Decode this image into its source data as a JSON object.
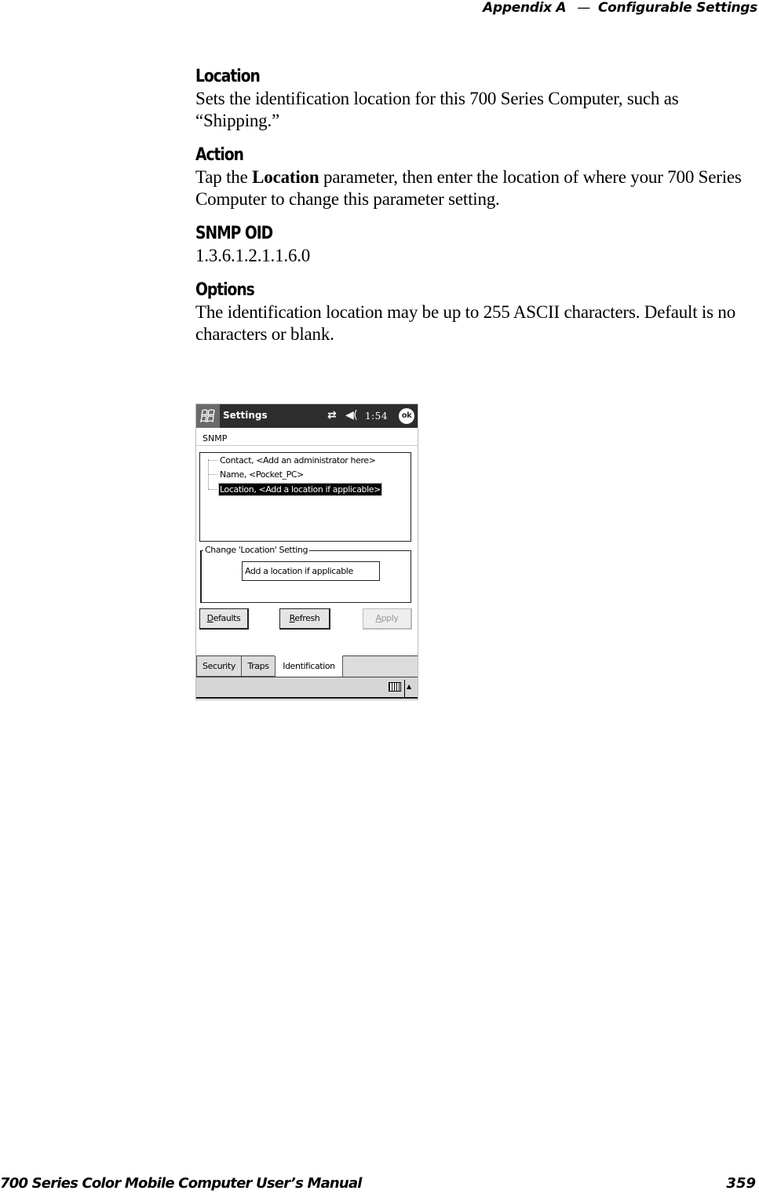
{
  "running_header": {
    "appendix": "Appendix A",
    "separator": "—",
    "chapter": "Configurable Settings"
  },
  "sections": [
    {
      "heading": "Location",
      "body": "Sets the identification location for this 700 Series Computer, such as “Shipping.”"
    },
    {
      "heading": "Action",
      "body_prefix": "Tap the ",
      "body_bold": "Location",
      "body_suffix": " parameter, then enter the location of where your 700 Series Computer to change this parameter setting."
    },
    {
      "heading": "SNMP OID",
      "body": "1.3.6.1.2.1.1.6.0"
    },
    {
      "heading": "Options",
      "body": "The identification location may be up to 255 ASCII characters. Default is no characters or blank."
    }
  ],
  "device_screen": {
    "titlebar": {
      "start_icon": "windows-flag-icon",
      "title": "Settings",
      "connectivity_icon": "connectivity-arrows-icon",
      "connectivity_glyph": "⇄",
      "volume_icon": "speaker-icon",
      "volume_glyph": "◀(",
      "time": "1:54",
      "ok_label": "ok"
    },
    "page_label": "SNMP",
    "tree_items": [
      {
        "label": "Contact,  <Add an administrator here>",
        "selected": false
      },
      {
        "label": "Name,  <Pocket_PC>",
        "selected": false
      },
      {
        "label": "Location,  <Add a location if applicable>",
        "selected": true
      }
    ],
    "groupbox": {
      "legend": "Change 'Location' Setting",
      "input_value": "Add a location if applicable"
    },
    "buttons": {
      "defaults_mnemonic": "D",
      "defaults_rest": "efaults",
      "refresh_mnemonic": "R",
      "refresh_rest": "efresh",
      "apply_mnemonic": "A",
      "apply_rest": "pply"
    },
    "tabs": [
      {
        "label": "Security",
        "active": false
      },
      {
        "label": "Traps",
        "active": false
      },
      {
        "label": "Identification",
        "active": true
      }
    ],
    "menubar": {
      "keyboard_icon": "keyboard-icon",
      "sip_arrow_glyph": "▲"
    }
  },
  "footer": {
    "manual_title": "700 Series Color Mobile Computer User’s Manual",
    "page_number": "359"
  }
}
